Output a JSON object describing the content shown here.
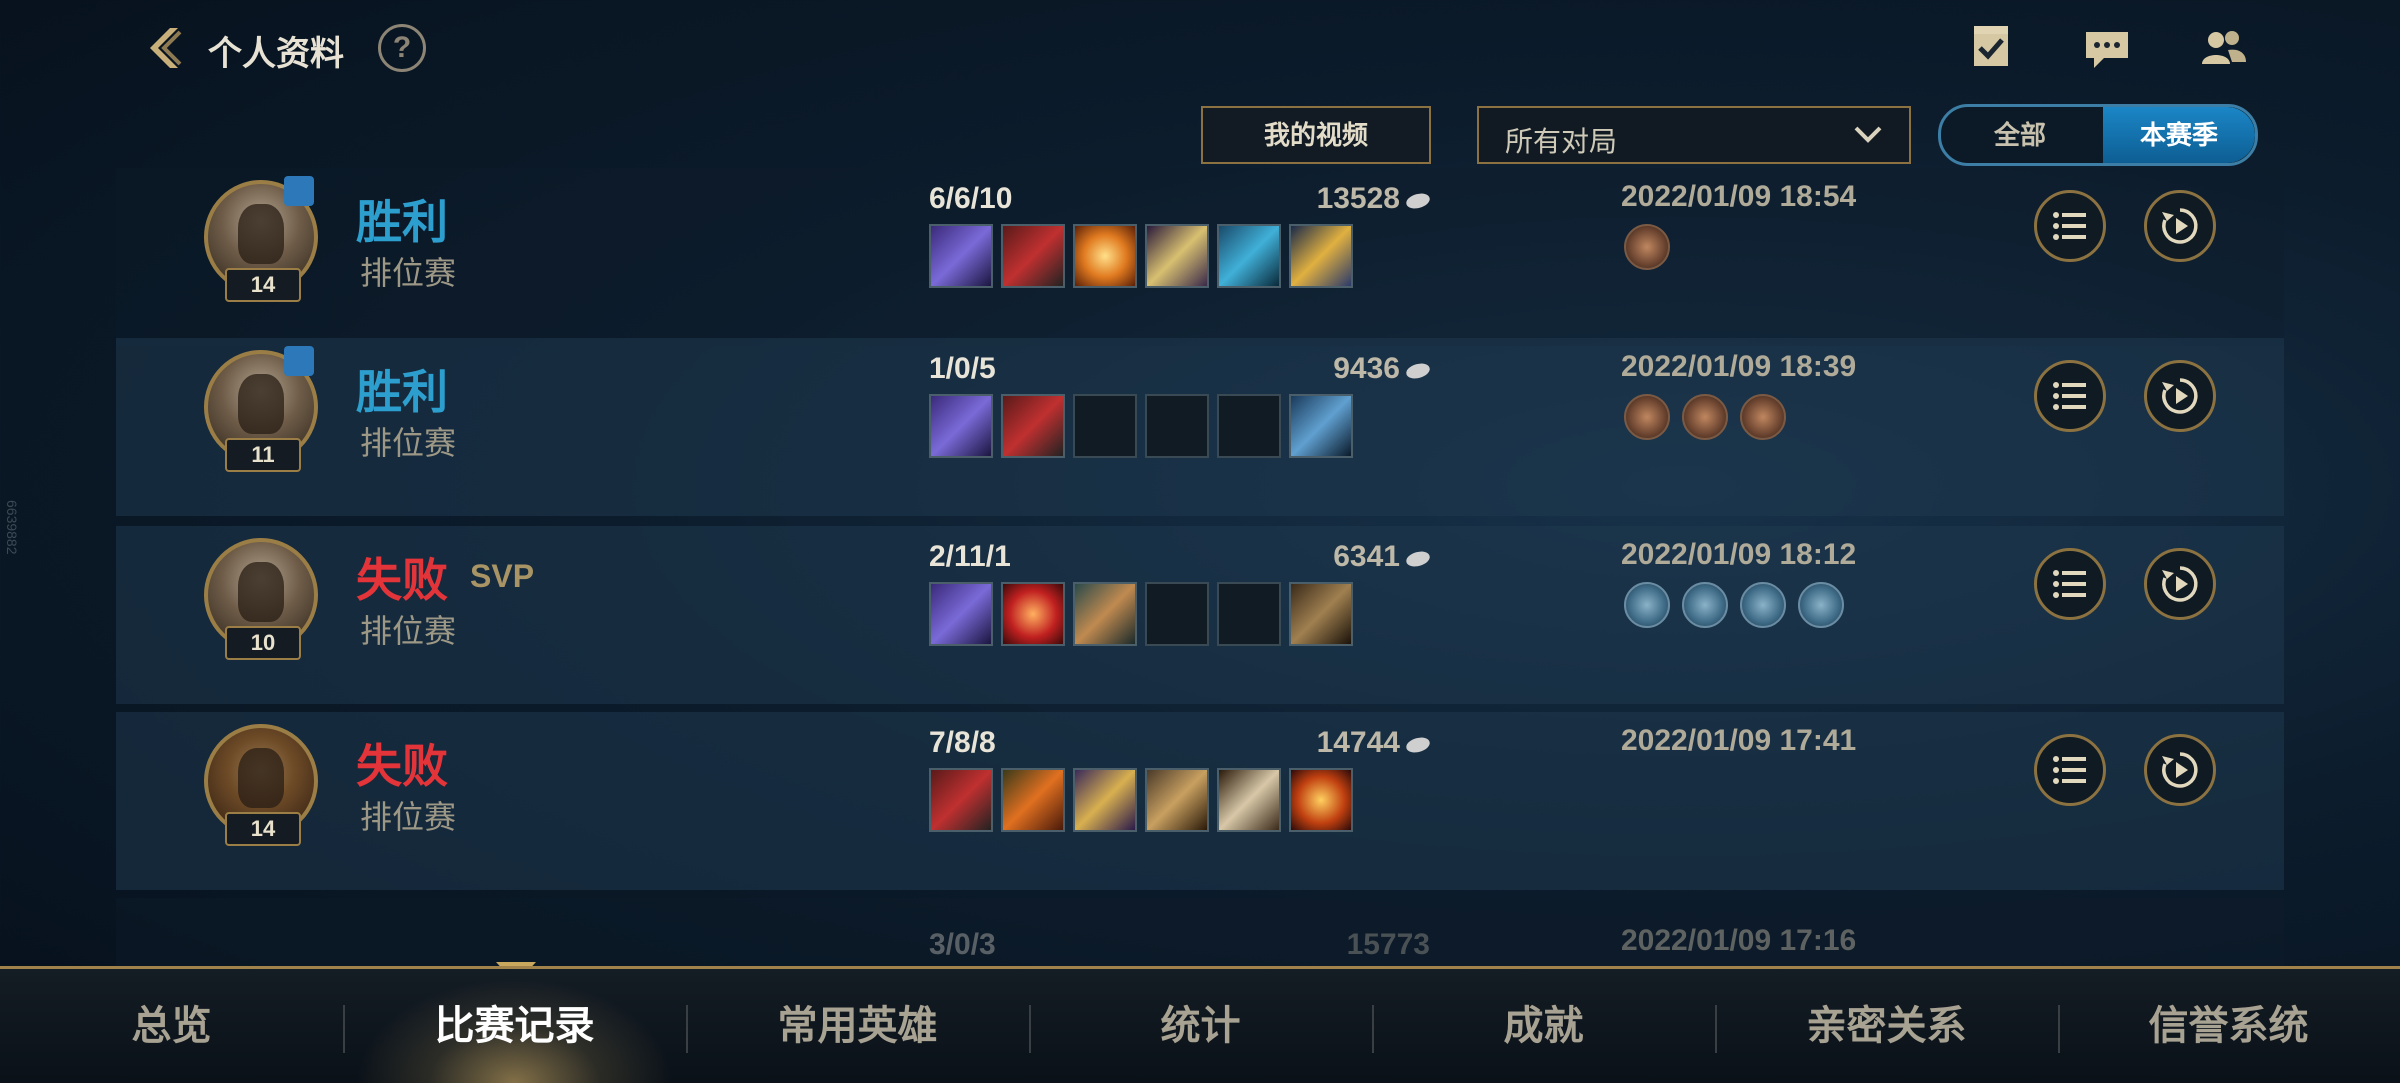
{
  "header": {
    "title": "个人资料",
    "help_label": "?",
    "icons": [
      "task-icon",
      "chat-icon",
      "friends-icon"
    ]
  },
  "filters": {
    "video_button": "我的视频",
    "match_select": "所有对局",
    "season_toggle": [
      "全部",
      "本赛季"
    ],
    "season_selected": "本赛季"
  },
  "side_text": "6639882",
  "matches": [
    {
      "level": "14",
      "result": "胜利",
      "result_type": "win",
      "svp": "",
      "mode": "排位赛",
      "kda": "6/6/10",
      "score": "13528",
      "date": "2022/01/09 18:54",
      "items": [
        "sword",
        "axe",
        "sun",
        "star",
        "armor",
        "flask"
      ],
      "badges": [
        "brown"
      ]
    },
    {
      "level": "11",
      "result": "胜利",
      "result_type": "win",
      "svp": "",
      "mode": "排位赛",
      "kda": "1/0/5",
      "score": "9436",
      "date": "2022/01/09 18:39",
      "items": [
        "sword",
        "axe",
        "empty",
        "empty",
        "empty",
        "boots-blue"
      ],
      "badges": [
        "brown",
        "brown",
        "brown"
      ]
    },
    {
      "level": "10",
      "result": "失败",
      "result_type": "lose",
      "svp": "SVP",
      "mode": "排位赛",
      "kda": "2/11/1",
      "score": "6341",
      "date": "2022/01/09 18:12",
      "items": [
        "sword",
        "orb",
        "hammer",
        "empty",
        "empty",
        "boots"
      ],
      "badges": [
        "blue",
        "blue",
        "blue",
        "blue"
      ]
    },
    {
      "level": "14",
      "result": "失败",
      "result_type": "lose",
      "svp": "",
      "mode": "排位赛",
      "kda": "7/8/8",
      "score": "14744",
      "date": "2022/01/09 17:41",
      "items": [
        "axe",
        "blade",
        "shield",
        "gauntlet",
        "belt",
        "emblem"
      ],
      "badges": []
    }
  ],
  "partial_row": {
    "kda": "3/0/3",
    "score": "15773",
    "date": "2022/01/09 17:16"
  },
  "tabs": [
    "总览",
    "比赛记录",
    "常用英雄",
    "统计",
    "成就",
    "亲密关系",
    "信誉系统"
  ],
  "active_tab": "比赛记录",
  "colors": {
    "win": "#2d9fcf",
    "lose": "#e3343a",
    "gold": "#8b7240",
    "accent_blue": "#1b86c6"
  }
}
